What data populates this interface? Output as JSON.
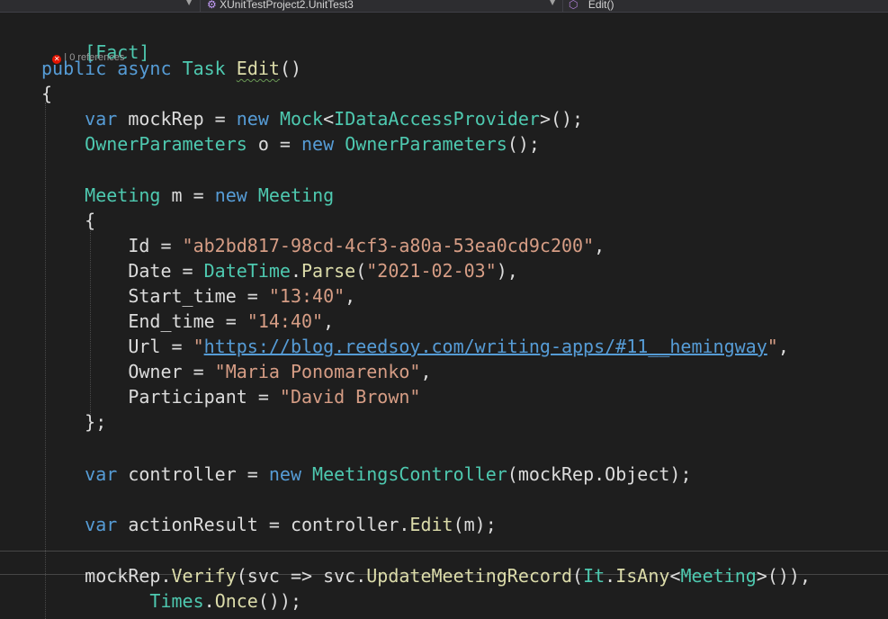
{
  "toolbar": {
    "project_dropdown": "XUnitTestProject2.UnitTest3",
    "member_dropdown": "Edit()",
    "project_icon": "class-icon",
    "member_icon": "method-icon"
  },
  "codelens": {
    "references": "0 references",
    "status_icon": "error-icon"
  },
  "code": {
    "l1": {
      "text": "[Fact]"
    },
    "l2": {
      "kw1": "public",
      "kw2": "async",
      "type": "Task",
      "name": "Edit",
      "rest": "()"
    },
    "l3": {
      "text": "{"
    },
    "l4": {
      "kw": "var",
      "id": "mockRep",
      "eq": " = ",
      "new": "new",
      "t1": "Mock",
      "lt": "<",
      "t2": "IDataAccessProvider",
      "rest": ">();"
    },
    "l5": {
      "type": "OwnerParameters",
      "id": " o = ",
      "new": "new",
      "type2": "OwnerParameters",
      "rest": "();"
    },
    "l6": {
      "type": "Meeting",
      "id": " m = ",
      "new": "new",
      "type2": "Meeting"
    },
    "l7": {
      "text": "{"
    },
    "l8": {
      "prop": "Id = ",
      "str": "\"ab2bd817-98cd-4cf3-a80a-53ea0cd9c200\"",
      "rest": ","
    },
    "l9": {
      "prop": "Date = ",
      "type": "DateTime",
      "dot": ".",
      "fn": "Parse",
      "open": "(",
      "str": "\"2021-02-03\"",
      "rest": "),"
    },
    "l10": {
      "prop": "Start_time = ",
      "str": "\"13:40\"",
      "rest": ","
    },
    "l11": {
      "prop": "End_time = ",
      "str": "\"14:40\"",
      "rest": ","
    },
    "l12": {
      "prop": "Url = ",
      "q1": "\"",
      "url": "https://blog.reedsoy.com/writing-apps/#11__hemingway",
      "q2": "\"",
      "rest": ","
    },
    "l13": {
      "prop": "Owner = ",
      "str": "\"Maria Ponomarenko\"",
      "rest": ","
    },
    "l14": {
      "prop": "Participant = ",
      "str": "\"David Brown\""
    },
    "l15": {
      "text": "};"
    },
    "l16": {
      "kw": "var",
      "id": " controller = ",
      "new": "new",
      "type": "MeetingsController",
      "open": "(",
      "arg": "mockRep.Object",
      "rest": ");"
    },
    "l17": {
      "kw": "var",
      "id": " actionResult = ",
      "obj": "controller.",
      "fn": "Edit",
      "rest": "(m);"
    },
    "l18": {
      "obj": "mockRep.",
      "fn": "Verify",
      "p1": "(svc => svc.",
      "fn2": "UpdateMeetingRecord",
      "p2": "(",
      "type": "It",
      "dot": ".",
      "fn3": "IsAny",
      "lt": "<",
      "type2": "Meeting",
      "rest": ">()),"
    },
    "l19": {
      "type": "Times",
      "dot": ".",
      "fn": "Once",
      "rest": "());"
    }
  }
}
